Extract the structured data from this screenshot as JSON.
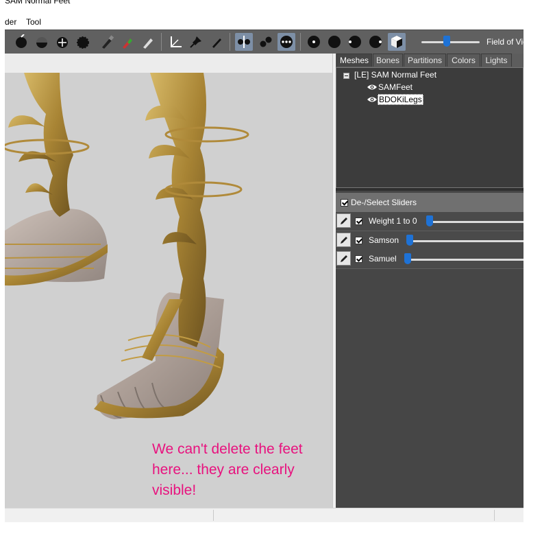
{
  "window": {
    "title": "SAM Normal Feet"
  },
  "menu": {
    "items": [
      "der",
      "Tool"
    ]
  },
  "toolbar": {
    "fov_label": "Field of View"
  },
  "viewport": {
    "annotation": "We can't delete the feet here... they are clearly visible!"
  },
  "right_panel": {
    "tabs": [
      {
        "label": "Meshes",
        "active": true
      },
      {
        "label": "Bones",
        "active": false
      },
      {
        "label": "Partitions",
        "active": false
      },
      {
        "label": "Colors",
        "active": false
      },
      {
        "label": "Lights",
        "active": false
      }
    ],
    "tree": {
      "root": "[LE] SAM Normal Feet",
      "meshes": [
        {
          "label": "SAMFeet",
          "selected": false
        },
        {
          "label": "BDOKiLegs",
          "selected": true
        }
      ]
    },
    "sliders_header": "De-/Select Sliders",
    "sliders": [
      {
        "label": "Weight 1 to 0",
        "checked": true,
        "value": 0.0
      },
      {
        "label": "Samson",
        "checked": true,
        "value": 0.0
      },
      {
        "label": "Samuel",
        "checked": true,
        "value": 0.0
      }
    ]
  },
  "colors": {
    "accent": "#1e72d6",
    "annotation": "#e8127e",
    "panel": "#464646"
  }
}
